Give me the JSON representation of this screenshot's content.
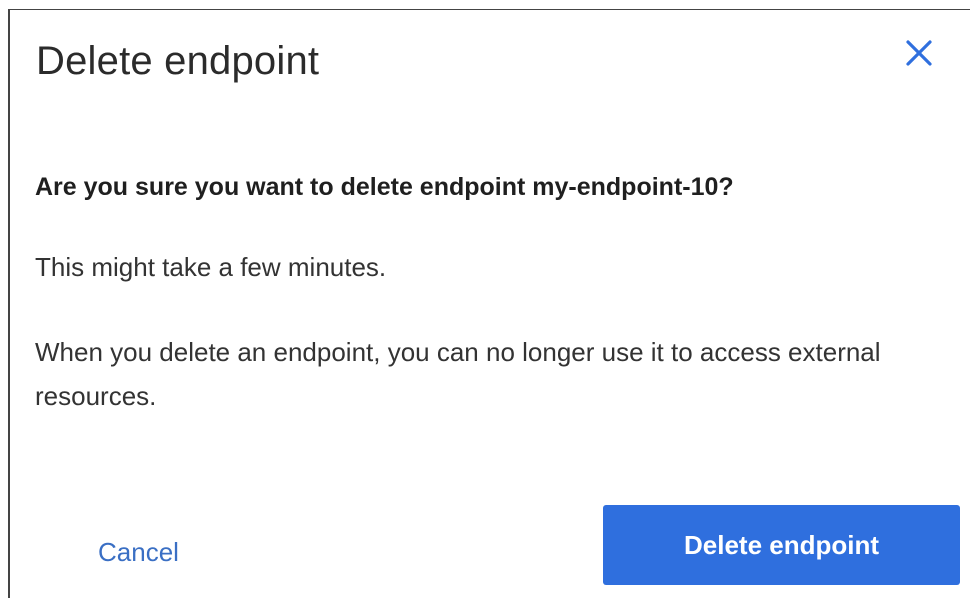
{
  "dialog": {
    "title": "Delete endpoint",
    "close_icon": "close-icon",
    "question": "Are you sure you want to delete endpoint my-endpoint-10?",
    "paragraphs": [
      "This might take a few minutes.",
      "When you delete an endpoint, you can no longer use it to access external resources."
    ]
  },
  "actions": {
    "cancel_label": "Cancel",
    "confirm_label": "Delete endpoint"
  },
  "colors": {
    "accent": "#2f6fde",
    "link": "#3a6fc4",
    "close_icon": "#2f6fde"
  }
}
